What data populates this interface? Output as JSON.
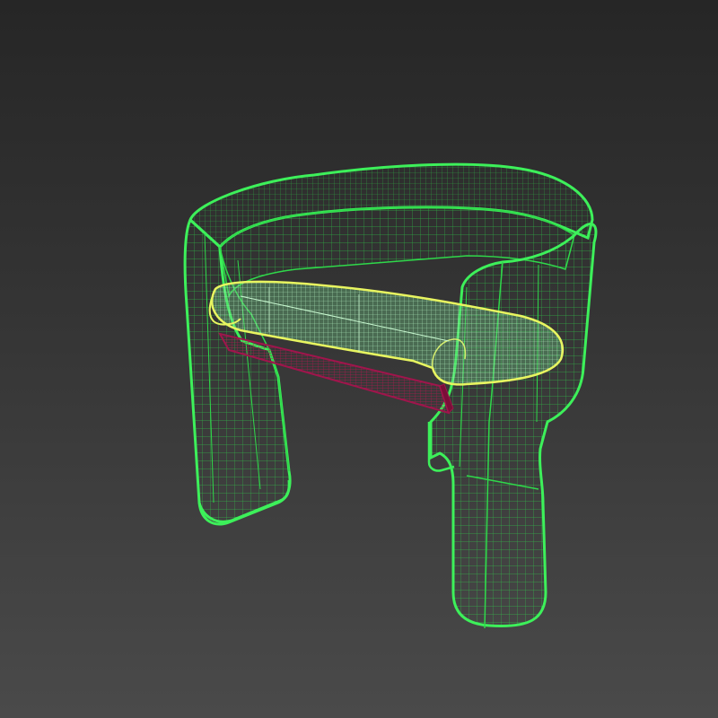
{
  "viewport": {
    "background_top": "#262626",
    "background_bottom": "#4a4a4a"
  },
  "model": {
    "display_mode": "wireframe",
    "object": "armchair",
    "parts": [
      {
        "name": "frame-shell",
        "wire_color": "#2fd84a",
        "outline_color": "#3df05a"
      },
      {
        "name": "seat-cushion",
        "wire_color": "#a8f5b8",
        "outline_color": "#e8f560"
      },
      {
        "name": "seat-base",
        "wire_color": "#8a1040",
        "outline_color": "#a0154c"
      }
    ]
  }
}
